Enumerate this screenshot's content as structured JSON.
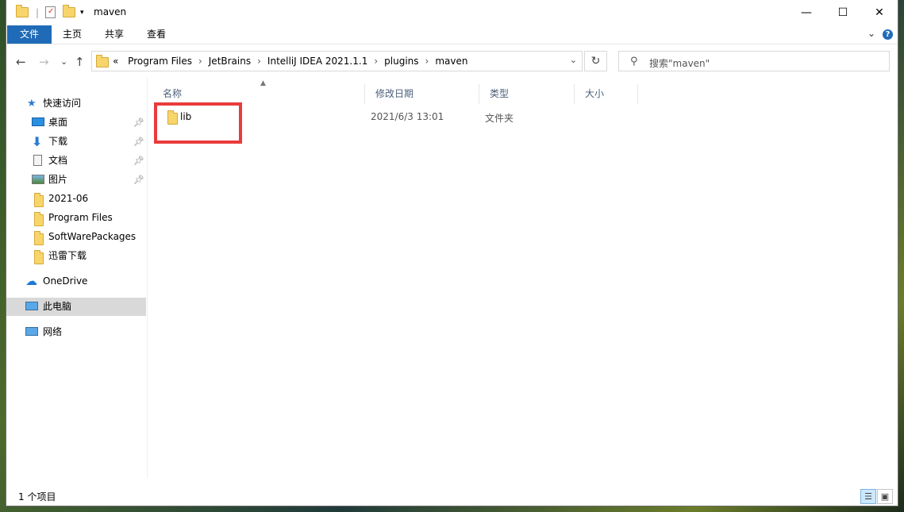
{
  "window": {
    "title": "maven"
  },
  "ribbon": {
    "tabs": [
      "文件",
      "主页",
      "共享",
      "查看"
    ]
  },
  "address": {
    "back_icon": "←",
    "forward_icon": "→",
    "dropdown_icon": "⌄",
    "up_icon": "↑",
    "overflow": "«",
    "crumbs": [
      "Program Files",
      "JetBrains",
      "IntelliJ IDEA 2021.1.1",
      "plugins",
      "maven"
    ],
    "refresh_icon": "↻"
  },
  "search": {
    "placeholder": "搜索\"maven\""
  },
  "sidebar": {
    "quick_access": "快速访问",
    "items": [
      {
        "label": "桌面",
        "icon": "desktop-icon",
        "pinned": true
      },
      {
        "label": "下载",
        "icon": "download-icon",
        "pinned": true
      },
      {
        "label": "文档",
        "icon": "document-icon",
        "pinned": true
      },
      {
        "label": "图片",
        "icon": "picture-icon",
        "pinned": true
      },
      {
        "label": "2021-06",
        "icon": "folder-icon",
        "pinned": false
      },
      {
        "label": "Program Files",
        "icon": "folder-icon",
        "pinned": false
      },
      {
        "label": "SoftWarePackages",
        "icon": "folder-icon",
        "pinned": false
      },
      {
        "label": "迅雷下载",
        "icon": "folder-icon",
        "pinned": false
      }
    ],
    "onedrive": "OneDrive",
    "this_pc": "此电脑",
    "network": "网络"
  },
  "columns": {
    "name": "名称",
    "modified": "修改日期",
    "type": "类型",
    "size": "大小"
  },
  "files": [
    {
      "name": "lib",
      "modified": "2021/6/3 13:01",
      "type": "文件夹",
      "size": ""
    }
  ],
  "status": {
    "count": "1 个项目"
  },
  "colors": {
    "accent": "#1f6bb7",
    "highlight": "#ea3b3b",
    "folder": "#f7d56a"
  }
}
